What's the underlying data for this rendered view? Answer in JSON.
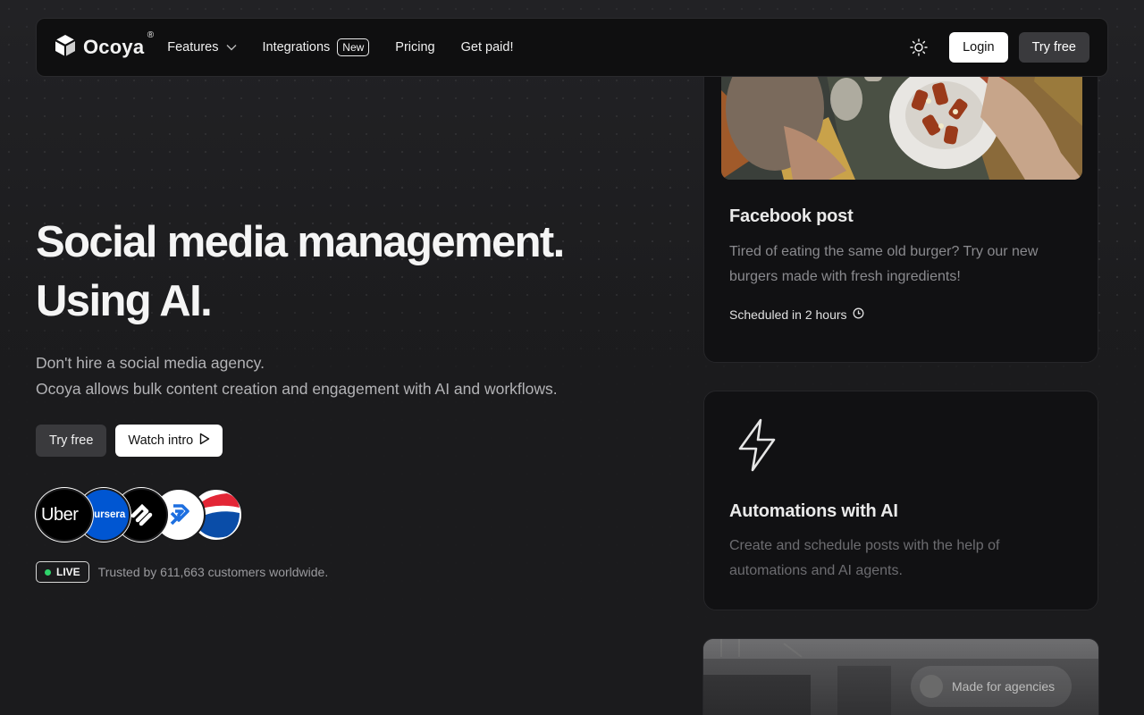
{
  "nav": {
    "logo_text": "Ocoya",
    "logo_mark": "®",
    "links": [
      {
        "label": "Features",
        "has_dropdown": true
      },
      {
        "label": "Integrations",
        "badge": "New"
      },
      {
        "label": "Pricing"
      },
      {
        "label": "Get paid!"
      }
    ],
    "theme_icon": "sun-icon",
    "login_label": "Login",
    "try_label": "Try free"
  },
  "hero": {
    "title_line1": "Social media management.",
    "title_line2": "Using AI.",
    "sub_line1": "Don't hire a social media agency.",
    "sub_line2": "Ocoya allows bulk content creation and engagement with AI and workflows.",
    "try_label": "Try free",
    "watch_label": "Watch intro",
    "customer_logos": [
      "Uber",
      "coursera",
      "Squarespace",
      "Ocoya",
      "Pepsi"
    ],
    "uber_text": "Uber",
    "coursera_text": "coursera",
    "live_label": "LIVE",
    "trust_text": "Trusted by 611,663 customers worldwide."
  },
  "cards": {
    "facebook": {
      "title": "Facebook post",
      "text": "Tired of eating the same old burger? Try our new burgers made with fresh ingredients!",
      "scheduled": "Scheduled in 2 hours"
    },
    "automations": {
      "title": "Automations with AI",
      "text": "Create and schedule posts with the help of automations and AI agents."
    },
    "agencies": {
      "label": "Made for agencies"
    }
  },
  "colors": {
    "background": "#1b1b1d",
    "live_dot": "#2fd36b",
    "coursera_blue": "#0056d2",
    "pepsi_blue": "#0a4da8",
    "pepsi_red": "#e32636"
  }
}
